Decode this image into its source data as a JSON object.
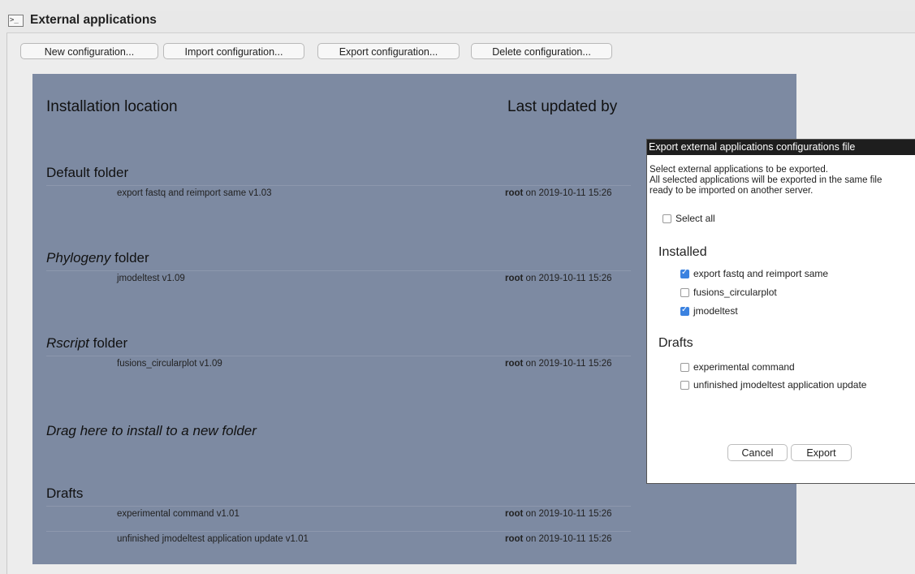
{
  "window": {
    "title": "External applications",
    "icon": "terminal-icon",
    "icon_glyph": ">_"
  },
  "toolbar": {
    "new": "New configuration...",
    "import": "Import configuration...",
    "export": "Export configuration...",
    "delete": "Delete configuration..."
  },
  "table": {
    "col_location": "Installation location",
    "col_updated": "Last updated by",
    "default_folder": {
      "label": "Default folder"
    },
    "phylogeny_folder": {
      "italic": "Phylogeny",
      "suffix": " folder"
    },
    "rscript_folder": {
      "italic": "Rscript",
      "suffix": " folder"
    },
    "rows": [
      {
        "name": "export fastq and reimport same v1.03",
        "user": "root",
        "date": " on 2019-10-11 15:26"
      },
      {
        "name": "jmodeltest v1.09",
        "user": "root",
        "date": " on 2019-10-11 15:26"
      },
      {
        "name": "fusions_circularplot v1.09",
        "user": "root",
        "date": " on 2019-10-11 15:26"
      }
    ],
    "drag_hint": "Drag here to install to a new folder",
    "drafts_label": "Drafts",
    "draft_rows": [
      {
        "name": "experimental command v1.01",
        "user": "root",
        "date": " on 2019-10-11 15:26"
      },
      {
        "name": "unfinished jmodeltest application update v1.01",
        "user": "root",
        "date": " on 2019-10-11 15:26"
      }
    ]
  },
  "dialog": {
    "title": "Export external applications configurations file",
    "desc1": "Select external applications to be exported.",
    "desc2": "All selected applications will be exported in the same file",
    "desc3": "ready to be imported on another server.",
    "select_all": "Select all",
    "installed_label": "Installed",
    "installed": [
      {
        "label": "export fastq and reimport same",
        "checked": true
      },
      {
        "label": "fusions_circularplot",
        "checked": false
      },
      {
        "label": "jmodeltest",
        "checked": true
      }
    ],
    "drafts_label": "Drafts",
    "drafts": [
      {
        "label": "experimental command",
        "checked": false
      },
      {
        "label": "unfinished jmodeltest application update",
        "checked": false
      }
    ],
    "cancel": "Cancel",
    "export": "Export"
  },
  "colors": {
    "panel": "#7d8aa2",
    "checkbox_on": "#3b82e0",
    "dialog_title_bg": "#1e1e1e"
  }
}
